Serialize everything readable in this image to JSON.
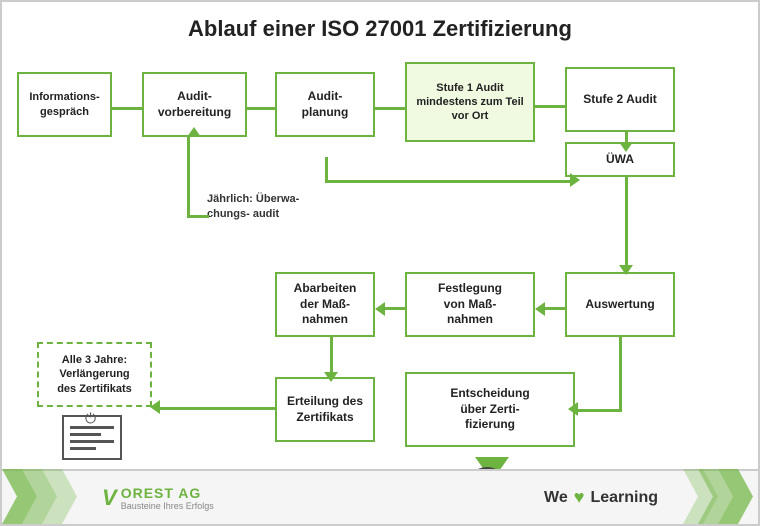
{
  "title": "Ablauf einer ISO 27001 Zertifizierung",
  "boxes": {
    "infoGespraech": "Informations-\ngespräch",
    "auditVorbereitung": "Audit-\nvorbereitung",
    "auditPlanung": "Audit-\nplanung",
    "stufe1Audit": "Stufe 1 Audit\nmindestens zum Teil\nvor Ort",
    "stufe2Audit": "Stufe 2 Audit",
    "uewa": "ÜWA",
    "jaehrlich": "Jährlich:\nÜberwa-\nchungs-\naudit",
    "abarbeiten": "Abarbeiten\nder Maß-\nnahmen",
    "festlegung": "Festlegung\nvon Maß-\nnahmen",
    "auswertung": "Auswertung",
    "erteilung": "Erteilung des\nZertifikats",
    "entscheidung": "Entscheidung\nüber Zerti-\nfizierung",
    "alle3Jahre": "Alle 3 Jahre:\nVerlängerung\ndes Zertifikats"
  },
  "footer": {
    "logo_v": "V",
    "logo_text": "OREST AG",
    "logo_sub": "Bausteine Ihres Erfolgs",
    "we": "We",
    "learning": "Learning"
  }
}
